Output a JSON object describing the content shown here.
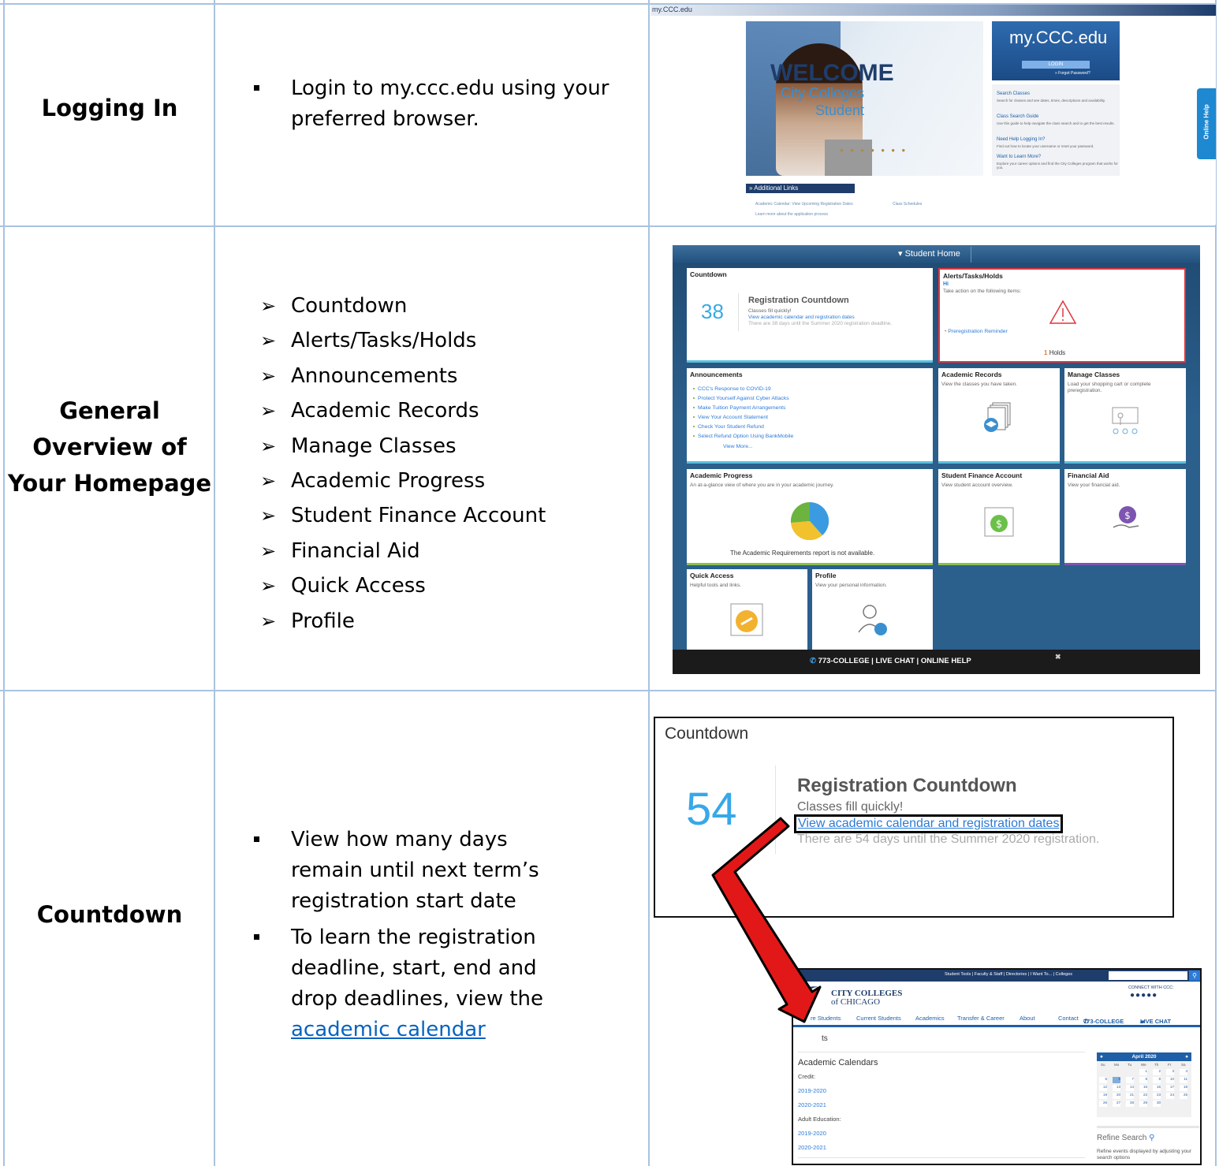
{
  "rows": [
    {
      "title": "Logging In",
      "bullets": [
        "Login to my.ccc.edu using your preferred browser."
      ]
    },
    {
      "title_lines": [
        "General",
        "Overview of",
        "Your Homepage"
      ],
      "items": [
        "Countdown",
        "Alerts/Tasks/Holds",
        "Announcements",
        "Academic Records",
        "Manage Classes",
        "Academic Progress",
        "Student Finance Account",
        "Financial Aid",
        "Quick Access",
        "Profile"
      ]
    },
    {
      "title": "Countdown",
      "bullet1": "View how many days remain until next term’s registration start date",
      "bullet2_text": "To learn the registration deadline, start, end and drop deadlines, view the",
      "bullet2_link": "academic calendar"
    }
  ],
  "login_shot": {
    "logo": "my.CCC.edu",
    "welcome": "WELCOME",
    "city_colleges": "City Colleges",
    "student": "Student",
    "box_title": "my.CCC.edu",
    "login_btn": "LOGIN",
    "forgot": "» Forgot Password?",
    "links": [
      "Search Classes",
      "Class Search Guide",
      "Need Help Logging In?",
      "Want to Learn More?"
    ],
    "additional": "» Additional Links",
    "al1": "Academic Calendar: View Upcoming Registration Dates",
    "al2": "Class Schedules",
    "al3": "Learn more about the application process",
    "online_help": "Online Help"
  },
  "home_shot": {
    "header": "▾ Student Home",
    "countdown": {
      "title": "Countdown",
      "num": "38",
      "head": "Registration Countdown",
      "l1": "Classes fill quickly!",
      "l2": "View academic calendar and registration dates",
      "l3": "There are 38 days until the Summer 2020 registration deadline."
    },
    "alerts": {
      "title": "Alerts/Tasks/Holds",
      "hi": "Hi",
      "take": "Take action on the following items:",
      "rem": "Preregistration Reminder",
      "holds_n": "1",
      "holds": "Holds"
    },
    "ann": {
      "title": "Announcements",
      "items": [
        "CCC's Response to COVID-19",
        "Protect Yourself Against Cyber Attacks",
        "Make Tuition Payment Arrangements",
        "View Your Account Statement",
        "Check Your Student Refund",
        "Select Refund Option Using BankMobile"
      ],
      "more": "View More..."
    },
    "records": {
      "title": "Academic Records",
      "desc": "View the classes you have taken."
    },
    "manage": {
      "title": "Manage Classes",
      "desc": "Load your shopping cart or complete preregistration."
    },
    "progress": {
      "title": "Academic Progress",
      "desc": "An at-a-glance view of where you are in your academic journey.",
      "note": "The Academic Requirements report is not available."
    },
    "finance": {
      "title": "Student Finance Account",
      "desc": "View student account overview."
    },
    "aid": {
      "title": "Financial Aid",
      "desc": "View your financial aid."
    },
    "quick": {
      "title": "Quick Access",
      "desc": "Helpful tools and links."
    },
    "profile": {
      "title": "Profile",
      "desc": "View your personal information."
    },
    "footer": "773-COLLEGE  |  LIVE CHAT  |  ONLINE HELP",
    "close": "✖"
  },
  "countdown_shot": {
    "title": "Countdown",
    "num": "54",
    "head": "Registration Countdown",
    "l1": "Classes fill quickly!",
    "l2": "View academic calendar and registration dates",
    "l3": "There are 54 days until the Summer 2020 registration."
  },
  "calendar_shot": {
    "topnav": "Student Tools  |  Faculty & Staff  |  Directories  |  I Want To...  |  Colleges",
    "brand1": "CITY COLLEGES",
    "brand2": "of CHICAGO",
    "connect": "CONNECT WITH CCC:",
    "nav": [
      "re Students",
      "Current Students",
      "Academics",
      "Transfer & Career",
      "About",
      "Contact",
      "773-COLLEGE",
      "LIVE CHAT"
    ],
    "events": "ts",
    "ac": "Academic Calendars",
    "credit": "Credit:",
    "c1": "2019-2020",
    "c2": "2020-2021",
    "adult": "Adult Education:",
    "a1": "2019-2020",
    "a2": "2020-2021",
    "month": "April 2020",
    "dows": [
      "Su",
      "Mo",
      "Tu",
      "We",
      "Th",
      "Fr",
      "Sa"
    ],
    "refine": "Refine Search",
    "refine_note": "Refine events displayed by adjusting your search options"
  }
}
